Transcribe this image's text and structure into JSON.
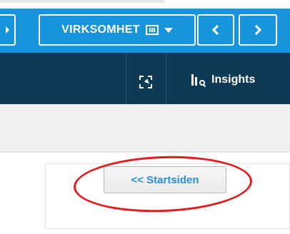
{
  "header": {
    "company_menu_label": "VIRKSOMHET",
    "chart_icon": "chart-icon",
    "dropdown_icon": "caret-down-icon",
    "prev_icon": "chevron-left-icon",
    "next_icon": "chevron-right-icon",
    "accent_color": "#1794da"
  },
  "toolbar": {
    "selection_icon": "selection-cursor-icon",
    "insights_icon": "insights-icon",
    "insights_label": "Insights",
    "background_color": "#0e3a55"
  },
  "main": {
    "start_button_label": "<< Startsiden",
    "link_color": "#2a8ed6"
  },
  "annotation": {
    "color": "#e51b1b"
  }
}
